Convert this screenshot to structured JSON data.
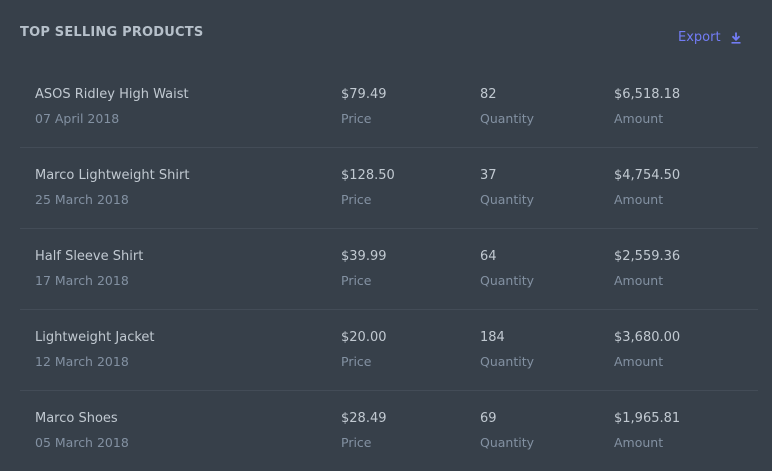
{
  "header": {
    "title": "TOP SELLING PRODUCTS",
    "export_label": "Export"
  },
  "icons": {
    "export": "download-icon"
  },
  "colors": {
    "background": "#37404a",
    "accent": "#727cf5"
  },
  "products": [
    {
      "name": "ASOS Ridley High Waist",
      "date": "07 April 2018",
      "price": "$79.49",
      "price_label": "Price",
      "quantity": "82",
      "quantity_label": "Quantity",
      "amount": "$6,518.18",
      "amount_label": "Amount"
    },
    {
      "name": "Marco Lightweight Shirt",
      "date": "25 March 2018",
      "price": "$128.50",
      "price_label": "Price",
      "quantity": "37",
      "quantity_label": "Quantity",
      "amount": "$4,754.50",
      "amount_label": "Amount"
    },
    {
      "name": "Half Sleeve Shirt",
      "date": "17 March 2018",
      "price": "$39.99",
      "price_label": "Price",
      "quantity": "64",
      "quantity_label": "Quantity",
      "amount": "$2,559.36",
      "amount_label": "Amount"
    },
    {
      "name": "Lightweight Jacket",
      "date": "12 March 2018",
      "price": "$20.00",
      "price_label": "Price",
      "quantity": "184",
      "quantity_label": "Quantity",
      "amount": "$3,680.00",
      "amount_label": "Amount"
    },
    {
      "name": "Marco Shoes",
      "date": "05 March 2018",
      "price": "$28.49",
      "price_label": "Price",
      "quantity": "69",
      "quantity_label": "Quantity",
      "amount": "$1,965.81",
      "amount_label": "Amount"
    }
  ]
}
